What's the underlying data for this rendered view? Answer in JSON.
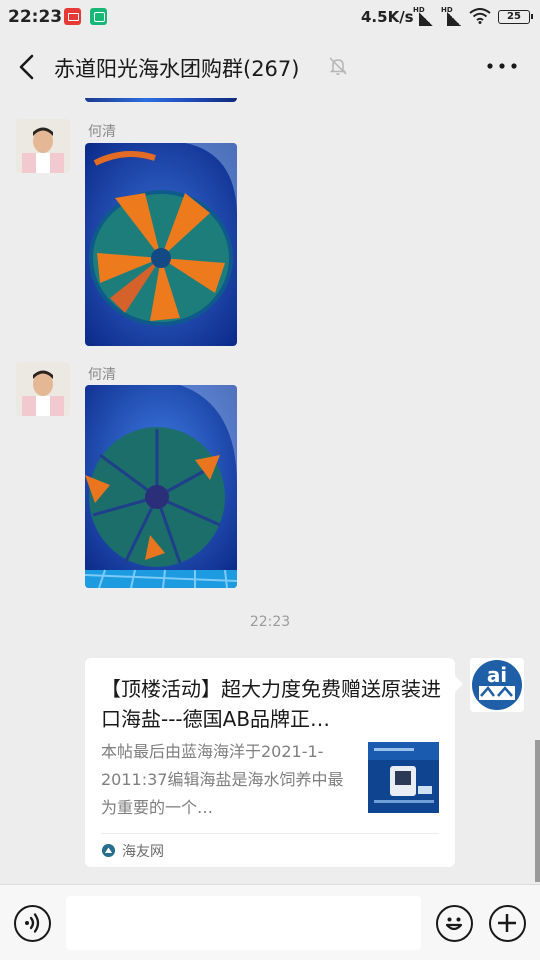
{
  "status_bar": {
    "time": "22:23",
    "net_speed": "4.5K/s",
    "signal_labels": [
      "HD",
      "HD"
    ],
    "battery": "25",
    "icons": [
      "app-notification-icon",
      "app-notification-icon-2",
      "signal-icon",
      "wifi-icon",
      "battery-icon"
    ]
  },
  "header": {
    "title": "赤道阳光海水团购群(267)",
    "muted": true
  },
  "messages": [
    {
      "sender": "何清",
      "type": "image",
      "image_desc": "coral-photo"
    },
    {
      "sender": "何清",
      "type": "image",
      "image_desc": "coral-photo"
    }
  ],
  "timestamp": "22:23",
  "card": {
    "title": "【顶楼活动】超大力度免费赠送原装进口海盐---德国AB品牌正…",
    "description": "本帖最后由蓝海海洋于2021-1-2011:37编辑海盐是海水饲养中最为重要的一个…",
    "source": "海友网"
  },
  "input": {
    "placeholder": ""
  },
  "colors": {
    "background": "#ededed",
    "card": "#ffffff",
    "meta_text": "#8a8a8a"
  }
}
